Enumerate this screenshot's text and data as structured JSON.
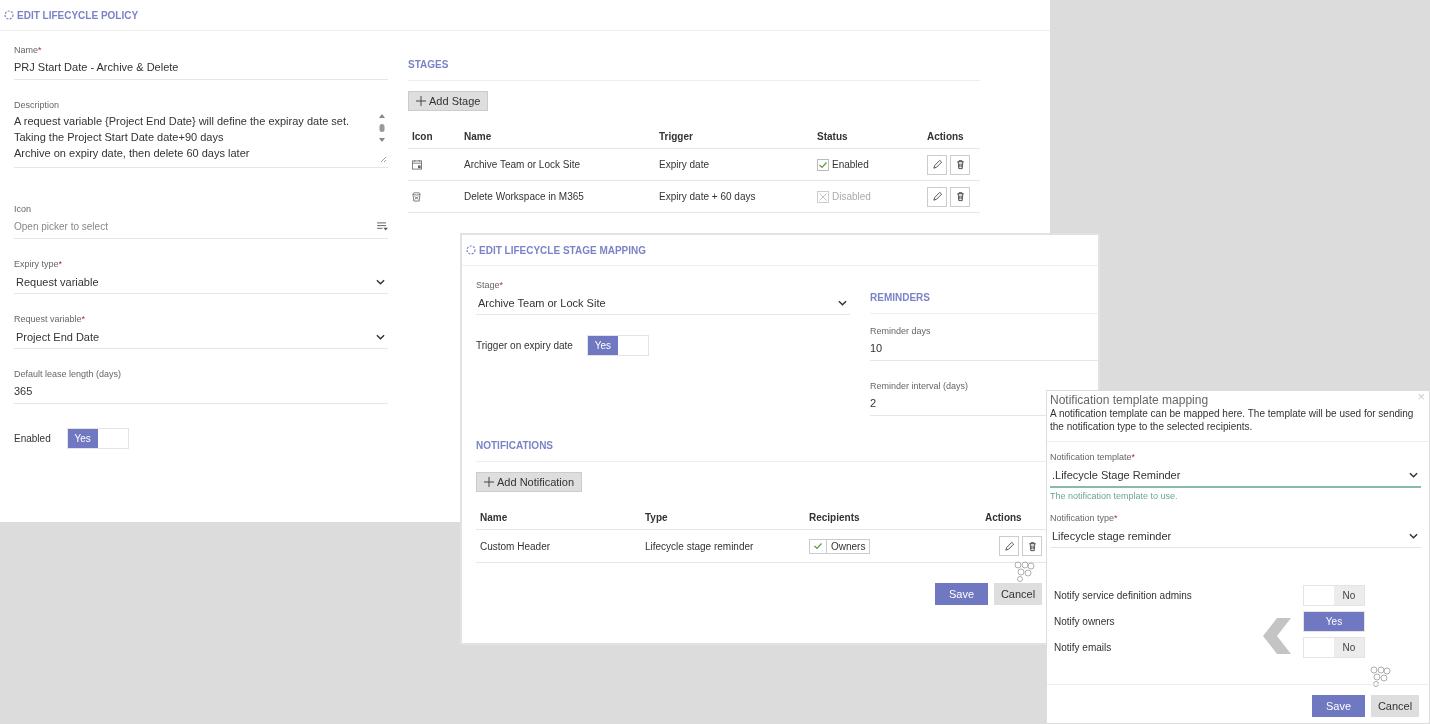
{
  "policy": {
    "title": "EDIT LIFECYCLE POLICY",
    "fields": [
      {
        "kind": "text",
        "label": "Name",
        "required_mark": "*",
        "value": "PRJ Start Date - Archive & Delete"
      },
      {
        "kind": "textarea",
        "label": "Description",
        "value": "A request variable {Project End Date} will define the expiray date set.\nTaking the Project Start Date date+90 days\nArchive on expiry date, then delete 60 days later"
      },
      {
        "kind": "picker",
        "label": "Icon",
        "placeholder": "Open picker to select"
      },
      {
        "kind": "select",
        "label": "Expiry type",
        "required_mark": "*",
        "value": "Request variable"
      },
      {
        "kind": "select",
        "label": "Request variable",
        "required_mark": "*",
        "value": "Project End Date"
      },
      {
        "kind": "text",
        "label": "Default lease length (days)",
        "value": "365"
      }
    ],
    "enabled": {
      "label": "Enabled",
      "on": true,
      "text": "Yes"
    },
    "stages": {
      "title": "STAGES",
      "add_button": "Add Stage",
      "columns": [
        "Icon",
        "Name",
        "Trigger",
        "Status",
        "Actions"
      ],
      "rows": [
        {
          "kind": "archive",
          "name": "Archive Team or Lock Site",
          "trigger": "Expiry date",
          "status": "Enabled",
          "enabled": true
        },
        {
          "kind": "delete",
          "name": "Delete Workspace in M365",
          "trigger": "Expiry date + 60 days",
          "status": "Disabled",
          "enabled": false
        }
      ]
    }
  },
  "stage_mapping": {
    "title": "EDIT LIFECYCLE STAGE MAPPING",
    "stage": {
      "label": "Stage",
      "required_mark": "*",
      "value": "Archive Team or Lock Site"
    },
    "trigger": {
      "label": "Trigger on expiry date",
      "on": true,
      "text": "Yes"
    },
    "reminders": {
      "title": "REMINDERS",
      "fields": [
        {
          "label": "Reminder days",
          "value": "10"
        },
        {
          "label": "Reminder interval (days)",
          "value": "2"
        }
      ]
    },
    "notifications": {
      "title": "NOTIFICATIONS",
      "add_button": "Add Notification",
      "columns": [
        "Name",
        "Type",
        "Recipients",
        "Actions"
      ],
      "rows": [
        {
          "name": "Custom Header",
          "type": "Lifecycle stage reminder",
          "recipients": [
            {
              "label": "Owners",
              "checked": true
            }
          ]
        }
      ]
    },
    "buttons": [
      "Save",
      "Cancel"
    ]
  },
  "template_mapping": {
    "title": "Notification template mapping",
    "close": "×",
    "description": "A notification template can be mapped here. The template will be used for sending the notification type to the selected recipients.",
    "template": {
      "label": "Notification template",
      "required_mark": "*",
      "value": ".Lifecycle Stage Reminder",
      "hint": "The notification template to use."
    },
    "type": {
      "label": "Notification type",
      "required_mark": "*",
      "value": "Lifecycle stage reminder"
    },
    "toggles": [
      {
        "label": "Notify service definition admins",
        "on": false,
        "text": "No"
      },
      {
        "label": "Notify owners",
        "on": true,
        "text": "Yes"
      },
      {
        "label": "Notify emails",
        "on": false,
        "text": "No"
      }
    ],
    "buttons": [
      "Save",
      "Cancel"
    ]
  }
}
